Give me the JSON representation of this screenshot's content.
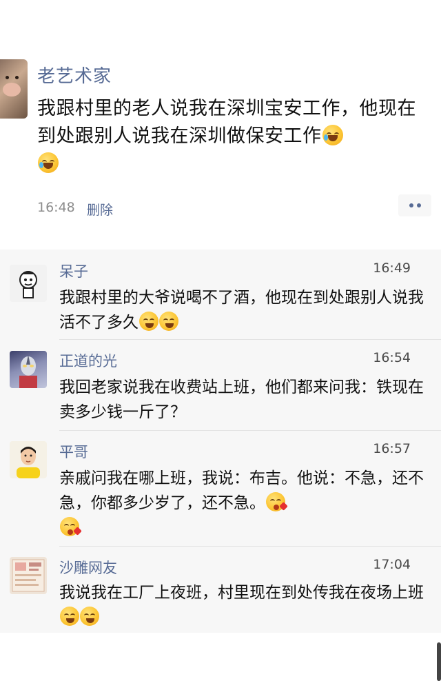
{
  "post": {
    "author": "老艺术家",
    "text": "我跟村里的老人说我在深圳宝安工作，他现在到处跟别人说我在深圳做保安工作",
    "emojis": [
      "laughing-crying-emoji",
      "laughing-crying-emoji"
    ],
    "time": "16:48",
    "delete_label": "删除",
    "more_icon": "more-dots-icon"
  },
  "comments": [
    {
      "name": "呆子",
      "time": "16:49",
      "text": "我跟村里的大爷说喝不了酒，他现在到处跟别人说我活不了多久",
      "emojis": [
        "grimace-emoji",
        "grimace-emoji"
      ]
    },
    {
      "name": "正道的光",
      "time": "16:54",
      "text": "我回老家说我在收费站上班，他们都来问我：铁现在卖多少钱一斤了？",
      "emojis": []
    },
    {
      "name": "平哥",
      "time": "16:57",
      "text": "亲戚问我在哪上班，我说：布吉。他说：不急，还不急，你都多少岁了，还不急。",
      "emojis": [
        "blow-kiss-emoji",
        "blow-kiss-emoji"
      ]
    },
    {
      "name": "沙雕网友",
      "time": "17:04",
      "text": "我说我在工厂上夜班，村里现在到处传我在夜场上班",
      "emojis": [
        "grimace-emoji",
        "grimace-emoji"
      ]
    }
  ],
  "colors": {
    "name_link": "#576b95",
    "comment_bg": "#f7f7f7",
    "text": "#111111",
    "muted": "#8c8c8c"
  }
}
